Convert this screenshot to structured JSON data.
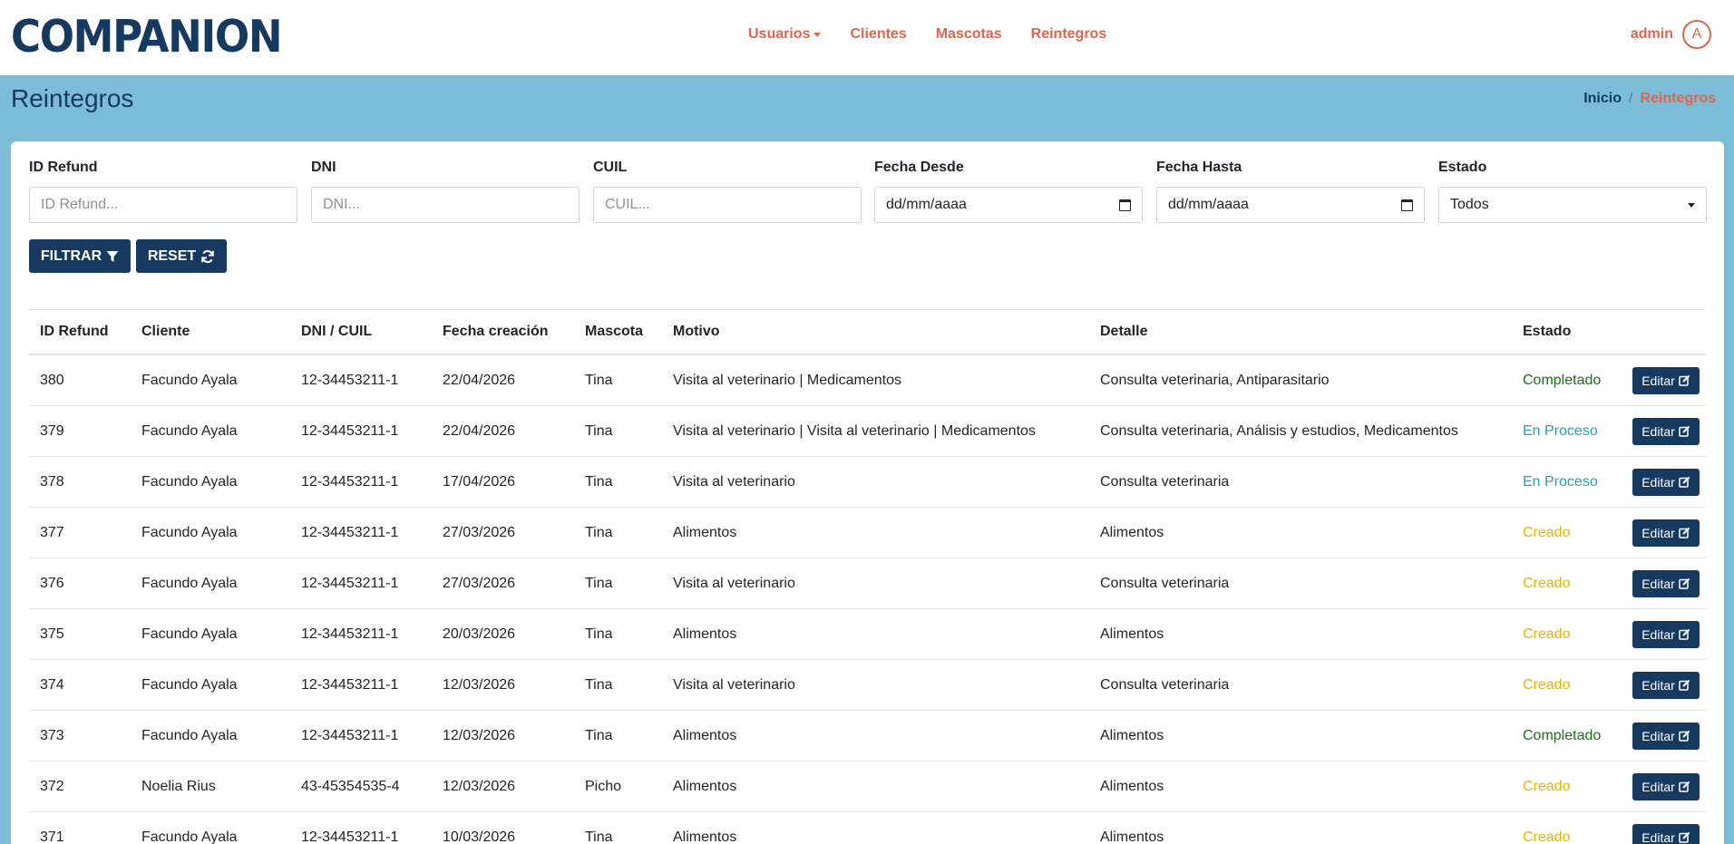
{
  "navbar": {
    "logo": "COMPANION",
    "links": [
      "Usuarios",
      "Clientes",
      "Mascotas",
      "Reintegros"
    ],
    "user": "admin",
    "avatar_initial": "A"
  },
  "page": {
    "title": "Reintegros",
    "breadcrumb": {
      "home": "Inicio",
      "separator": "/",
      "current": "Reintegros"
    }
  },
  "filters": {
    "id_refund": {
      "label": "ID Refund",
      "placeholder": "ID Refund..."
    },
    "dni": {
      "label": "DNI",
      "placeholder": "DNI..."
    },
    "cuil": {
      "label": "CUIL",
      "placeholder": "CUIL..."
    },
    "fecha_desde": {
      "label": "Fecha Desde",
      "value": "dd/mm/aaaa"
    },
    "fecha_hasta": {
      "label": "Fecha Hasta",
      "value": "dd/mm/aaaa"
    },
    "estado": {
      "label": "Estado",
      "value": "Todos"
    },
    "filter_button": "FILTRAR",
    "reset_button": "RESET"
  },
  "table": {
    "headers": [
      "ID Refund",
      "Cliente",
      "DNI / CUIL",
      "Fecha creación",
      "Mascota",
      "Motivo",
      "Detalle",
      "Estado"
    ],
    "edit_label": "Editar",
    "rows": [
      {
        "id": "380",
        "cliente": "Facundo Ayala",
        "dni": "12-34453211-1",
        "fecha": "22/04/2026",
        "mascota": "Tina",
        "motivo": "Visita al veterinario | Medicamentos",
        "detalle": "Consulta veterinaria, Antiparasitario",
        "estado": "Completado"
      },
      {
        "id": "379",
        "cliente": "Facundo Ayala",
        "dni": "12-34453211-1",
        "fecha": "22/04/2026",
        "mascota": "Tina",
        "motivo": "Visita al veterinario | Visita al veterinario | Medicamentos",
        "detalle": "Consulta veterinaria, Análisis y estudios, Medicamentos",
        "estado": "En Proceso"
      },
      {
        "id": "378",
        "cliente": "Facundo Ayala",
        "dni": "12-34453211-1",
        "fecha": "17/04/2026",
        "mascota": "Tina",
        "motivo": "Visita al veterinario",
        "detalle": "Consulta veterinaria",
        "estado": "En Proceso"
      },
      {
        "id": "377",
        "cliente": "Facundo Ayala",
        "dni": "12-34453211-1",
        "fecha": "27/03/2026",
        "mascota": "Tina",
        "motivo": "Alimentos",
        "detalle": "Alimentos",
        "estado": "Creado"
      },
      {
        "id": "376",
        "cliente": "Facundo Ayala",
        "dni": "12-34453211-1",
        "fecha": "27/03/2026",
        "mascota": "Tina",
        "motivo": "Visita al veterinario",
        "detalle": "Consulta veterinaria",
        "estado": "Creado"
      },
      {
        "id": "375",
        "cliente": "Facundo Ayala",
        "dni": "12-34453211-1",
        "fecha": "20/03/2026",
        "mascota": "Tina",
        "motivo": "Alimentos",
        "detalle": "Alimentos",
        "estado": "Creado"
      },
      {
        "id": "374",
        "cliente": "Facundo Ayala",
        "dni": "12-34453211-1",
        "fecha": "12/03/2026",
        "mascota": "Tina",
        "motivo": "Visita al veterinario",
        "detalle": "Consulta veterinaria",
        "estado": "Creado"
      },
      {
        "id": "373",
        "cliente": "Facundo Ayala",
        "dni": "12-34453211-1",
        "fecha": "12/03/2026",
        "mascota": "Tina",
        "motivo": "Alimentos",
        "detalle": "Alimentos",
        "estado": "Completado"
      },
      {
        "id": "372",
        "cliente": "Noelia Rius",
        "dni": "43-45354535-4",
        "fecha": "12/03/2026",
        "mascota": "Picho",
        "motivo": "Alimentos",
        "detalle": "Alimentos",
        "estado": "Creado"
      },
      {
        "id": "371",
        "cliente": "Facundo Ayala",
        "dni": "12-34453211-1",
        "fecha": "10/03/2026",
        "mascota": "Tina",
        "motivo": "Alimentos",
        "detalle": "Alimentos",
        "estado": "Creado"
      }
    ]
  },
  "status_colors": {
    "Completado": "#1a6e1a",
    "En Proceso": "#2a9db5",
    "Creado": "#e6b400"
  },
  "icons": {
    "filter": "filter-icon",
    "reset": "refresh-icon",
    "edit": "edit-icon",
    "calendar": "calendar-icon",
    "select": "chevron-down-icon"
  }
}
